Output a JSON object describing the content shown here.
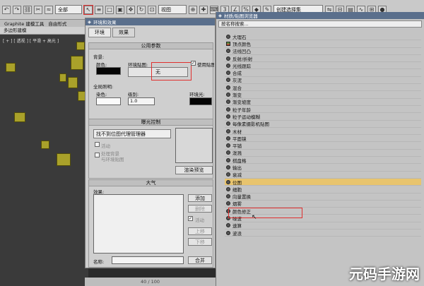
{
  "toolbar": {
    "filter_label": "全部",
    "ref_coord": "视图",
    "selection_set": "创建选择集"
  },
  "ribbon": {
    "tab1": "Graphite 建模工具",
    "tab2": "自由形式",
    "sub": "多边形建模"
  },
  "viewport": {
    "label": "[ + ] [ 透视 ] [ 平滑 + 高光 ]"
  },
  "env": {
    "title": "环境和效果",
    "tab_env": "环境",
    "tab_effects": "效果",
    "common_title": "公用参数",
    "background": "背景:",
    "color": "颜色:",
    "env_map": "环境贴图:",
    "use_map": "使用贴图",
    "map_none": "无",
    "global_light": "全局照明:",
    "tint": "染色:",
    "level": "级别:",
    "level_value": "1.0",
    "ambient": "环境光:",
    "exposure_title": "曝光控制",
    "exposure_value": "找不到位图代理管理器",
    "active": "活动",
    "process_bg": "处理背景",
    "and_env": "与环境贴图",
    "render_preview": "渲染预览",
    "atmos_title": "大气",
    "effects": "效果:",
    "add": "添加",
    "delete": "删除",
    "active2": "活动",
    "move_up": "上移",
    "move_down": "下移",
    "name": "名称:",
    "merge": "合并"
  },
  "browser": {
    "title": "材质/贴图浏览器",
    "search": "按名称搜索...",
    "items": [
      "大理石",
      "顶点颜色",
      "法线凹凸",
      "反射/折射",
      "光线跟踪",
      "合成",
      "灰泥",
      "混合",
      "渐变",
      "渐变坡度",
      "粒子年龄",
      "粒子运动模糊",
      "每像素摄影机贴图",
      "木材",
      "平面镜",
      "平铺",
      "泼溅",
      "棋盘格",
      "输出",
      "衰减",
      "位图",
      "细胞",
      "向量置换",
      "烟雾",
      "颜色修正",
      "噪波",
      "速算",
      "波浪"
    ]
  },
  "status": "40 / 100",
  "watermark": "元码手游网"
}
